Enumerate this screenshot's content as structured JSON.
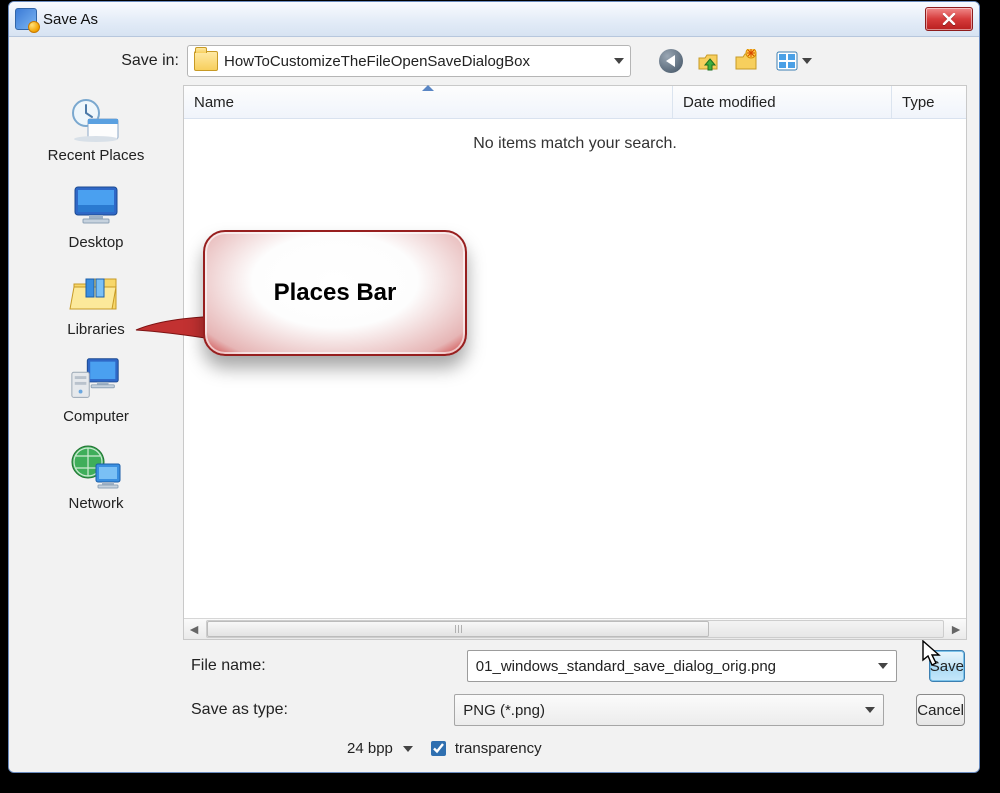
{
  "window": {
    "title": "Save As"
  },
  "save_in": {
    "label": "Save in:",
    "folder": "HowToCustomizeTheFileOpenSaveDialogBox"
  },
  "places": [
    {
      "id": "recent",
      "label": "Recent Places"
    },
    {
      "id": "desktop",
      "label": "Desktop"
    },
    {
      "id": "libraries",
      "label": "Libraries"
    },
    {
      "id": "computer",
      "label": "Computer"
    },
    {
      "id": "network",
      "label": "Network"
    }
  ],
  "columns": {
    "name": "Name",
    "date": "Date modified",
    "type": "Type"
  },
  "empty_message": "No items match your search.",
  "file_name": {
    "label": "File name:",
    "value": "01_windows_standard_save_dialog_orig.png"
  },
  "save_type": {
    "label": "Save as type:",
    "value": "PNG (*.png)"
  },
  "bpp": {
    "value": "24 bpp"
  },
  "transparency": {
    "label": "transparency",
    "checked": true
  },
  "buttons": {
    "save": "Save",
    "cancel": "Cancel"
  },
  "callout": {
    "text": "Places Bar"
  }
}
